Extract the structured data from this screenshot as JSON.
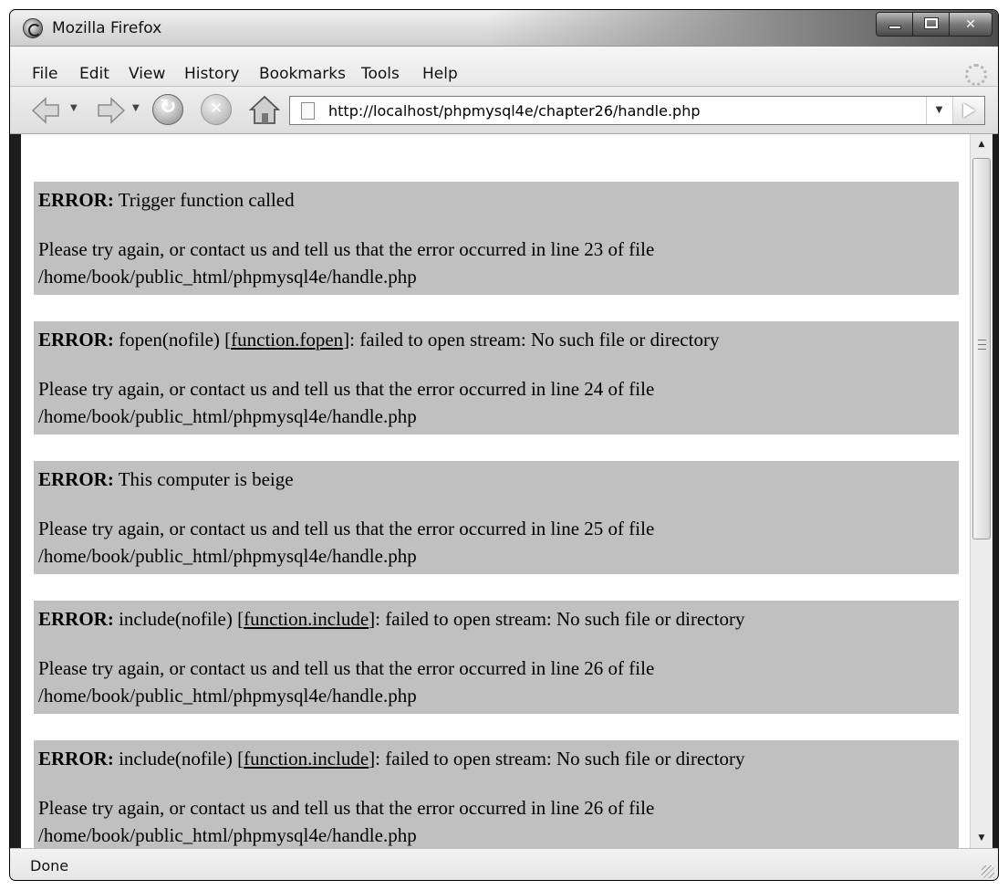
{
  "window": {
    "title": "Mozilla Firefox"
  },
  "menu": {
    "items": [
      "File",
      "Edit",
      "View",
      "History",
      "Bookmarks",
      "Tools",
      "Help"
    ]
  },
  "navigation": {
    "url": "http://localhost/phpmysql4e/chapter26/handle.php",
    "icons": [
      "back-icon",
      "forward-icon",
      "reload-icon",
      "stop-icon",
      "home-icon",
      "go-icon"
    ]
  },
  "errors": [
    {
      "label": "ERROR:",
      "message": "Trigger function called",
      "detail": "Please try again, or contact us and tell us that the error occurred in line 23 of file",
      "file": "/home/book/public_html/phpmysql4e/handle.php"
    },
    {
      "label": "ERROR:",
      "message_pre": "fopen(nofile) [",
      "link": "function.fopen",
      "message_post": "]: failed to open stream: No such file or directory",
      "detail": "Please try again, or contact us and tell us that the error occurred in line 24 of file",
      "file": "/home/book/public_html/phpmysql4e/handle.php"
    },
    {
      "label": "ERROR:",
      "message": "This computer is beige",
      "detail": "Please try again, or contact us and tell us that the error occurred in line 25 of file",
      "file": "/home/book/public_html/phpmysql4e/handle.php"
    },
    {
      "label": "ERROR:",
      "message_pre": "include(nofile) [",
      "link": "function.include",
      "message_post": "]: failed to open stream: No such file or directory",
      "detail": "Please try again, or contact us and tell us that the error occurred in line 26 of file",
      "file": "/home/book/public_html/phpmysql4e/handle.php"
    },
    {
      "label": "ERROR:",
      "message_pre": "include(nofile) [",
      "link": "function.include",
      "message_post": "]: failed to open stream: No such file or directory",
      "detail": "Please try again, or contact us and tell us that the error occurred in line 26 of file",
      "file": "/home/book/public_html/phpmysql4e/handle.php"
    }
  ],
  "status": {
    "text": "Done"
  },
  "colors": {
    "error_background": "#c0c0c0",
    "page_background": "#ffffff"
  }
}
